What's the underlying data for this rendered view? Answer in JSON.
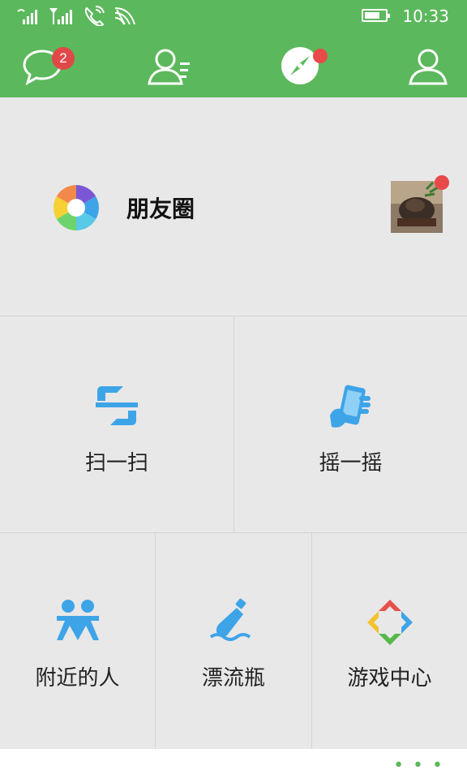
{
  "status_bar": {
    "time": "10:33",
    "battery_level": 0.75,
    "icons": [
      "signal-icon",
      "signal-no-sim-icon",
      "wifi-calling-icon",
      "wifi-icon"
    ]
  },
  "tabs": [
    {
      "name": "chats",
      "icon": "chat-bubble-icon",
      "badge": "2"
    },
    {
      "name": "contacts",
      "icon": "contacts-icon"
    },
    {
      "name": "discover",
      "icon": "compass-icon",
      "active": true,
      "dot": true
    },
    {
      "name": "me",
      "icon": "person-icon"
    }
  ],
  "moments": {
    "label": "朋友圈",
    "icon": "moments-aperture-icon",
    "has_new": true
  },
  "features": {
    "scan": {
      "label": "扫一扫",
      "icon": "scan-icon"
    },
    "shake": {
      "label": "摇一摇",
      "icon": "shake-phone-icon"
    },
    "nearby": {
      "label": "附近的人",
      "icon": "people-nearby-icon"
    },
    "bottle": {
      "label": "漂流瓶",
      "icon": "drift-bottle-icon"
    },
    "games": {
      "label": "游戏中心",
      "icon": "game-center-icon"
    }
  },
  "bottom_bar": {
    "more_label": "• • •"
  },
  "colors": {
    "primary": "#5cb85c",
    "badge": "#e04848",
    "icon_blue": "#3ea4e8"
  }
}
